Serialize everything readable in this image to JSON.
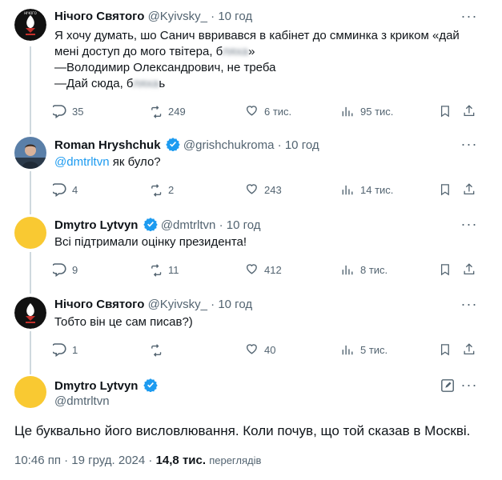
{
  "tweets": [
    {
      "name": "Нічого Святого",
      "handle": "@Kyivsky_",
      "time": "10 год",
      "text_part1": "Я хочу думать, шо Санич ввривався в кабінет до смминка з криком «дай мені доступ до мого твітера, б",
      "text_blur1": "ляха",
      "text_part2": "»\n—Володимир Олександрович, не треба\n—Дай сюда, б",
      "text_blur2": "ляха",
      "text_part3": "ь",
      "replies": "35",
      "reposts": "249",
      "likes": "6 тис.",
      "views": "95 тис."
    },
    {
      "name": "Roman Hryshchuk",
      "handle": "@grishchukroma",
      "time": "10 год",
      "mention": "@dmtrltvn",
      "text": " як було?",
      "replies": "4",
      "reposts": "2",
      "likes": "243",
      "views": "14 тис."
    },
    {
      "name": "Dmytro Lytvyn",
      "handle": "@dmtrltvn",
      "time": "10 год",
      "text": "Всі підтримали оцінку президента!",
      "replies": "9",
      "reposts": "11",
      "likes": "412",
      "views": "8 тис."
    },
    {
      "name": "Нічого Святого",
      "handle": "@Kyivsky_",
      "time": "10 год",
      "text": "Тобто він це сам писав?)",
      "replies": "1",
      "reposts": "",
      "likes": "40",
      "views": "5 тис."
    }
  ],
  "main": {
    "name": "Dmytro Lytvyn",
    "handle": "@dmtrltvn",
    "text": "Це буквально його висловлювання. Коли почув, що той сказав в Москві.",
    "timestamp": "10:46 пп · 19 груд. 2024 ·",
    "views_count": "14,8 тис.",
    "views_label": "переглядів"
  },
  "separator": "·",
  "more_glyph": "···",
  "colors": {
    "accent": "#1d9bf0",
    "muted": "#536471",
    "line": "#cfd9de",
    "avatar_yellow": "#f9c932"
  }
}
